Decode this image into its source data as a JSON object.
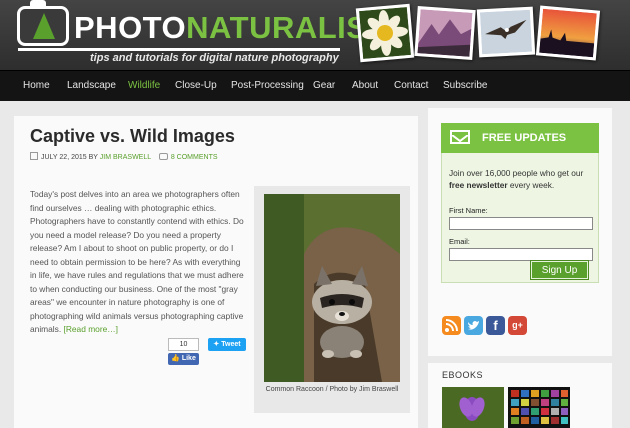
{
  "header": {
    "logo_left": "PHOTO",
    "logo_right": "NATURALIST",
    "tagline": "tips and tutorials for digital nature photography"
  },
  "nav": {
    "items": [
      "Home",
      "Landscape",
      "Wildlife",
      "Close-Up",
      "Post-Processing",
      "Gear",
      "About",
      "Contact",
      "Subscribe"
    ],
    "active": "Wildlife"
  },
  "post": {
    "title": "Captive vs. Wild Images",
    "date": "JULY 22, 2015",
    "by": "BY",
    "author": "JIM BRASWELL",
    "comments": "8 COMMENTS",
    "body": "Today's post delves into an area we photographers often find ourselves … dealing with photographic ethics. Photographers have to constantly contend with ethics. Do you need a model release? Do you need a property release? Am I about to shoot on public property, or do I need to obtain permission to be here? As with everything in life, we have rules and regulations that we must adhere to when conducting our business. One of the most \"gray areas\" we encounter in nature photography is one of photographing wild animals versus photographing captive animals.",
    "read_more": "[Read more…]",
    "fb_count": "10",
    "fb_like": "Like",
    "tweet": "Tweet",
    "photo_caption": "Common Raccoon / Photo by Jim Braswell"
  },
  "sidebar": {
    "newsletter": {
      "title": "FREE UPDATES",
      "text_before": "Join over 16,000 people who get our ",
      "text_bold": "free newsletter",
      "text_after": " every week.",
      "first_name_label": "First Name:",
      "email_label": "Email:",
      "button": "Sign Up"
    },
    "social": [
      "rss-icon",
      "twitter-icon",
      "facebook-icon",
      "google-plus-icon"
    ],
    "ebooks_title": "EBOOKS"
  },
  "colors": {
    "accent": "#7cc242",
    "link": "#5aa02c",
    "nav_bg": "#141414",
    "header_bg": "#3a3a3a"
  }
}
